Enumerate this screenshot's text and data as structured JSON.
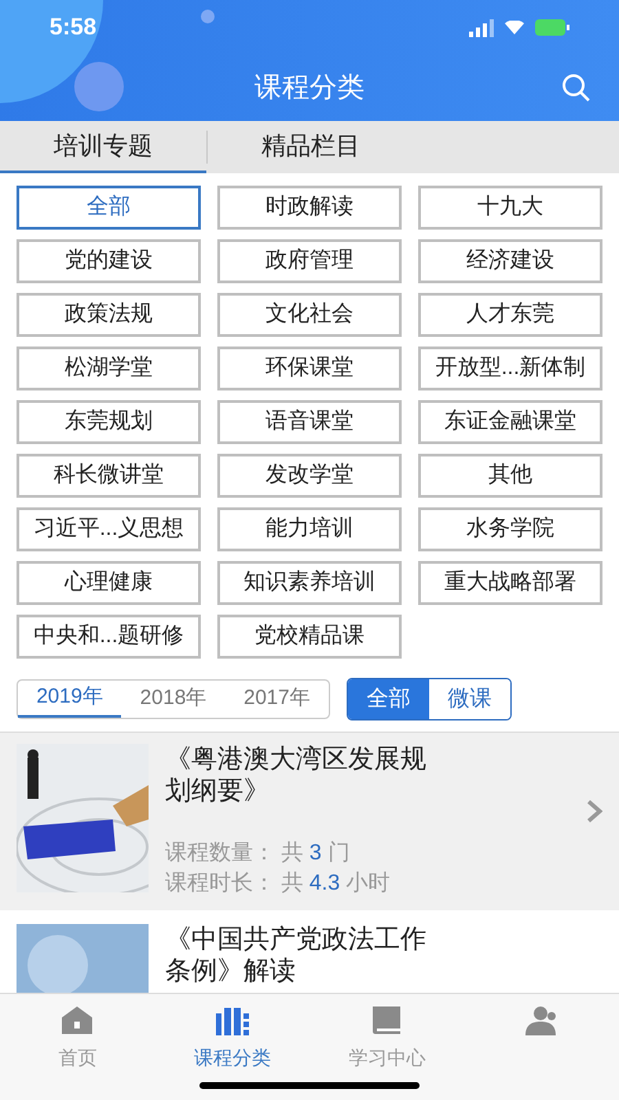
{
  "status_bar": {
    "time": "5:58"
  },
  "header": {
    "title": "课程分类"
  },
  "tabs": [
    {
      "label": "培训专题",
      "selected": true
    },
    {
      "label": "精品栏目",
      "selected": false
    }
  ],
  "categories": [
    {
      "label": "全部",
      "selected": true
    },
    {
      "label": "时政解读",
      "selected": false
    },
    {
      "label": "十九大",
      "selected": false
    },
    {
      "label": "党的建设",
      "selected": false
    },
    {
      "label": "政府管理",
      "selected": false
    },
    {
      "label": "经济建设",
      "selected": false
    },
    {
      "label": "政策法规",
      "selected": false
    },
    {
      "label": "文化社会",
      "selected": false
    },
    {
      "label": "人才东莞",
      "selected": false
    },
    {
      "label": "松湖学堂",
      "selected": false
    },
    {
      "label": "环保课堂",
      "selected": false
    },
    {
      "label": "开放型...新体制",
      "selected": false
    },
    {
      "label": "东莞规划",
      "selected": false
    },
    {
      "label": "语音课堂",
      "selected": false
    },
    {
      "label": "东证金融课堂",
      "selected": false
    },
    {
      "label": "科长微讲堂",
      "selected": false
    },
    {
      "label": "发改学堂",
      "selected": false
    },
    {
      "label": "其他",
      "selected": false
    },
    {
      "label": "习近平...义思想",
      "selected": false
    },
    {
      "label": "能力培训",
      "selected": false
    },
    {
      "label": "水务学院",
      "selected": false
    },
    {
      "label": "心理健康",
      "selected": false
    },
    {
      "label": "知识素养培训",
      "selected": false
    },
    {
      "label": "重大战略部署",
      "selected": false
    },
    {
      "label": "中央和...题研修",
      "selected": false
    },
    {
      "label": "党校精品课",
      "selected": false
    }
  ],
  "years": [
    {
      "label": "2019年",
      "selected": true
    },
    {
      "label": "2018年",
      "selected": false
    },
    {
      "label": "2017年",
      "selected": false
    }
  ],
  "types": [
    {
      "label": "全部",
      "selected": true
    },
    {
      "label": "微课",
      "selected": false
    }
  ],
  "courses": [
    {
      "title": "《粤港澳大湾区发展规划纲要》",
      "selected": true,
      "count_label": "课程数量：",
      "count_prefix": "共",
      "count": "3",
      "count_unit": "门",
      "duration_label": "课程时长：",
      "duration_prefix": "共",
      "duration": "4.3",
      "duration_unit": "小时"
    },
    {
      "title": "《中国共产党政法工作条例》解读",
      "selected": false
    }
  ],
  "bottom_nav": [
    {
      "label": "首页",
      "kind": "home",
      "selected": false
    },
    {
      "label": "课程分类",
      "kind": "category",
      "selected": true
    },
    {
      "label": "学习中心",
      "kind": "book",
      "selected": false
    },
    {
      "kind": "person",
      "selected": false
    }
  ]
}
